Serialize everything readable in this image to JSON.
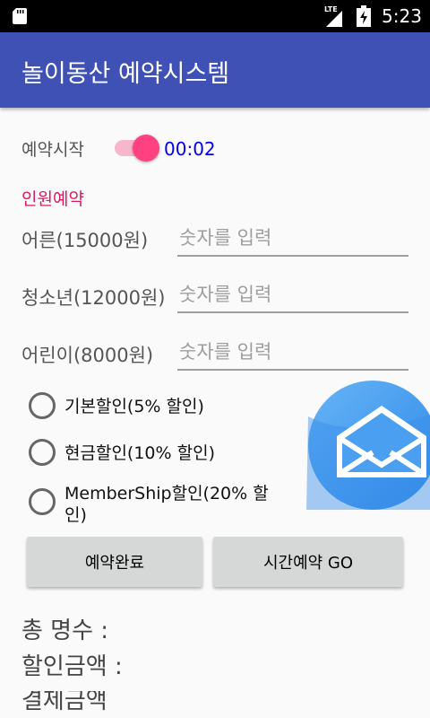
{
  "status_bar": {
    "network_label": "LTE",
    "time": "5:23"
  },
  "app_bar": {
    "title": "놀이동산 예약시스템"
  },
  "reservation_start": {
    "label": "예약시작",
    "switch_on": true,
    "timer": "00:02"
  },
  "people_section": {
    "title": "인원예약",
    "fields": [
      {
        "label": "어른(15000원)",
        "placeholder": "숫자를 입력",
        "value": ""
      },
      {
        "label": "청소년(12000원)",
        "placeholder": "숫자를 입력",
        "value": ""
      },
      {
        "label": "어린이(8000원)",
        "placeholder": "숫자를 입력",
        "value": ""
      }
    ]
  },
  "discounts": [
    {
      "label": "기본할인(5% 할인)",
      "checked": false
    },
    {
      "label": "현금할인(10% 할인)",
      "checked": false
    },
    {
      "label": "MemberShip할인(20% 할인)",
      "checked": false
    }
  ],
  "image": {
    "icon": "mail-icon",
    "colors": {
      "circle": "#4a9ff0",
      "envelope": "#ffffff"
    }
  },
  "buttons": {
    "complete": "예약완료",
    "time_reserve": "시간예약 GO"
  },
  "summary": {
    "total_count": "총 명수 :",
    "discount_amount": "할인금액 :",
    "payment_amount": "결제금액"
  },
  "colors": {
    "primary": "#3f51b5",
    "accent": "#ff4081",
    "section_title": "#d81b60",
    "timer": "#0000ee"
  }
}
